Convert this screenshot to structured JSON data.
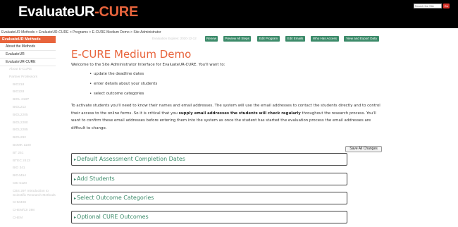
{
  "header": {
    "logo_white": "EvaluateUR",
    "logo_orange": "-CURE",
    "search_placeholder": "Search the Site",
    "go_label": "Go"
  },
  "breadcrumb": [
    "EvaluateUR Methods",
    "EvaluateUR-CURE",
    "Programs",
    "E-CURE Medium Demo",
    "Site Administrator"
  ],
  "breadcrumb_sep": " > ",
  "sidebar": {
    "header": "EvaluateUR Methods",
    "items": [
      "About the Methods",
      "EvaluateUR",
      "EvaluateUR-CURE"
    ],
    "faded": [
      {
        "label": "About E-CURE",
        "level": 2
      },
      {
        "label": "Partner Professors",
        "level": 2
      },
      {
        "label": "BIO218",
        "level": 3
      },
      {
        "label": "BIO228",
        "level": 3
      },
      {
        "label": "BIOL 218P",
        "level": 3
      },
      {
        "label": "BIOL212",
        "level": 3
      },
      {
        "label": "BIOL2205",
        "level": 3
      },
      {
        "label": "BIOL2280",
        "level": 3
      },
      {
        "label": "BIOL2285",
        "level": 3
      },
      {
        "label": "BIOL292",
        "level": 3
      },
      {
        "label": "BOMK 1100",
        "level": 3
      },
      {
        "label": "BT 251",
        "level": 3
      },
      {
        "label": "BTEC 2413",
        "level": 3
      },
      {
        "label": "BIO 341",
        "level": 3
      },
      {
        "label": "BIO4454",
        "level": 3
      },
      {
        "label": "CBI 5120",
        "level": 3
      },
      {
        "label": "CBS 297 Introduction to Scientific Research Methods",
        "level": 3,
        "wrap": true
      },
      {
        "label": "CHM408",
        "level": 3
      },
      {
        "label": "CHEM/CII 398",
        "level": 3
      },
      {
        "label": "CHEM",
        "level": 3
      }
    ]
  },
  "toolbar": {
    "expire_text": "Evaluation Expires: 2020-12-12",
    "buttons": [
      "Renew",
      "Preview All Steps",
      "Edit Program",
      "Edit Emails",
      "Who Has Access",
      "View and Export Data"
    ]
  },
  "main": {
    "title": "E-CURE Medium Demo",
    "intro": "Welcome to the Site Administrator Interface for EvaluateUR-CURE. You'll want to:",
    "bullets": [
      "update the deadline dates",
      "enter details about your students",
      "select outcome categories"
    ],
    "para_pre": "To activate students you'll need to know their names and email addresses. The system will use the email addresses to contact the students directly and to control their access to the online forms. So it is critical that you ",
    "para_bold": "supply email addresses the students will check regularly",
    "para_post": " throughout the research process. You'll want to confirm these email addresses before entering them into the system as once the student has started the evaluation process the email addresses are difficult to change.",
    "save_label": "Save All Changes",
    "sections": [
      "Default Assessment Completion Dates",
      "Add Students",
      "Select Outcome Categories",
      "Optional CURE Outcomes"
    ]
  },
  "colors": {
    "accent_orange": "#e8643c",
    "button_green": "#3c8b6a",
    "go_red": "#d9342b"
  }
}
